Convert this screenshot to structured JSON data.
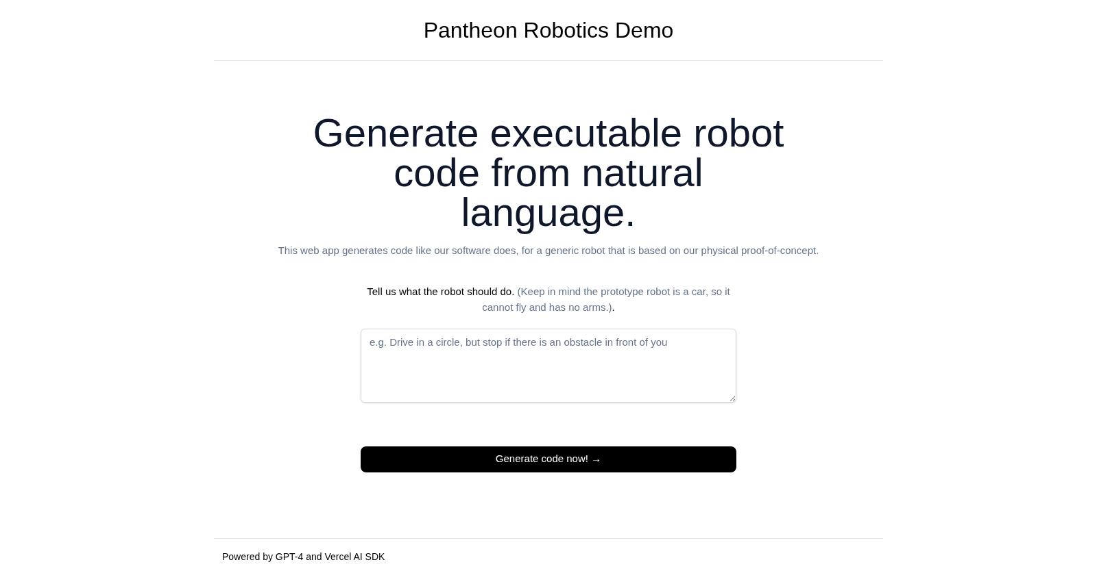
{
  "header": {
    "title": "Pantheon Robotics Demo"
  },
  "hero": {
    "heading": "Generate executable robot code from natural language.",
    "subtitle": "This web app generates code like our software does, for a generic robot that is based on our physical proof-of-concept."
  },
  "prompt": {
    "instruction": "Tell us what the robot should do.",
    "note": "(Keep in mind the prototype robot is a car, so it cannot fly and has no arms.)",
    "end": ".",
    "placeholder": "e.g. Drive in a circle, but stop if there is an obstacle in front of you"
  },
  "button": {
    "label": "Generate code now! →"
  },
  "footer": {
    "text": "Powered by GPT-4 and Vercel AI SDK"
  }
}
